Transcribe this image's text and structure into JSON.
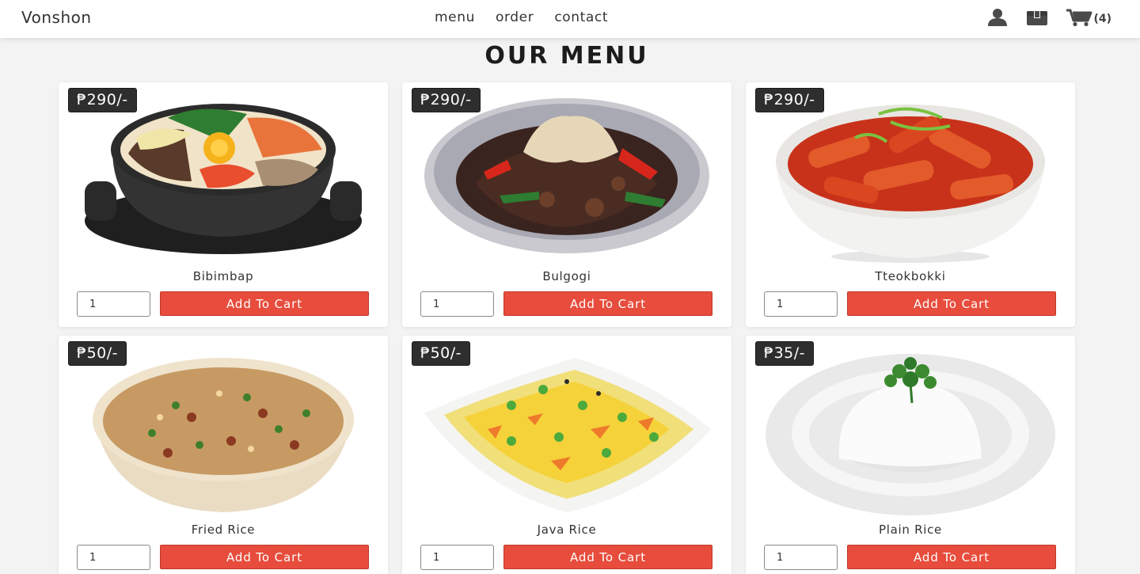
{
  "brand": "Vonshon",
  "nav": [
    "menu",
    "order",
    "contact"
  ],
  "header_icons": {
    "user": "user-icon",
    "box": "box-icon",
    "cart": "cart-icon",
    "cart_count": "(4)"
  },
  "page_title": "OUR MENU",
  "add_to_cart_label": "Add To Cart",
  "menu": [
    {
      "name": "Bibimbap",
      "price": "₱290/-",
      "qty": "1",
      "image": "bibimbap-dish"
    },
    {
      "name": "Bulgogi",
      "price": "₱290/-",
      "qty": "1",
      "image": "bulgogi-dish"
    },
    {
      "name": "Tteokbokki",
      "price": "₱290/-",
      "qty": "1",
      "image": "tteokbokki-dish"
    },
    {
      "name": "Fried Rice",
      "price": "₱50/-",
      "qty": "1",
      "image": "fried-rice-dish"
    },
    {
      "name": "Java Rice",
      "price": "₱50/-",
      "qty": "1",
      "image": "java-rice-dish"
    },
    {
      "name": "Plain Rice",
      "price": "₱35/-",
      "qty": "1",
      "image": "plain-rice-dish"
    }
  ],
  "colors": {
    "accent": "#e74c3c",
    "price_badge": "#2e2e2e",
    "background": "#f3f3f3"
  }
}
